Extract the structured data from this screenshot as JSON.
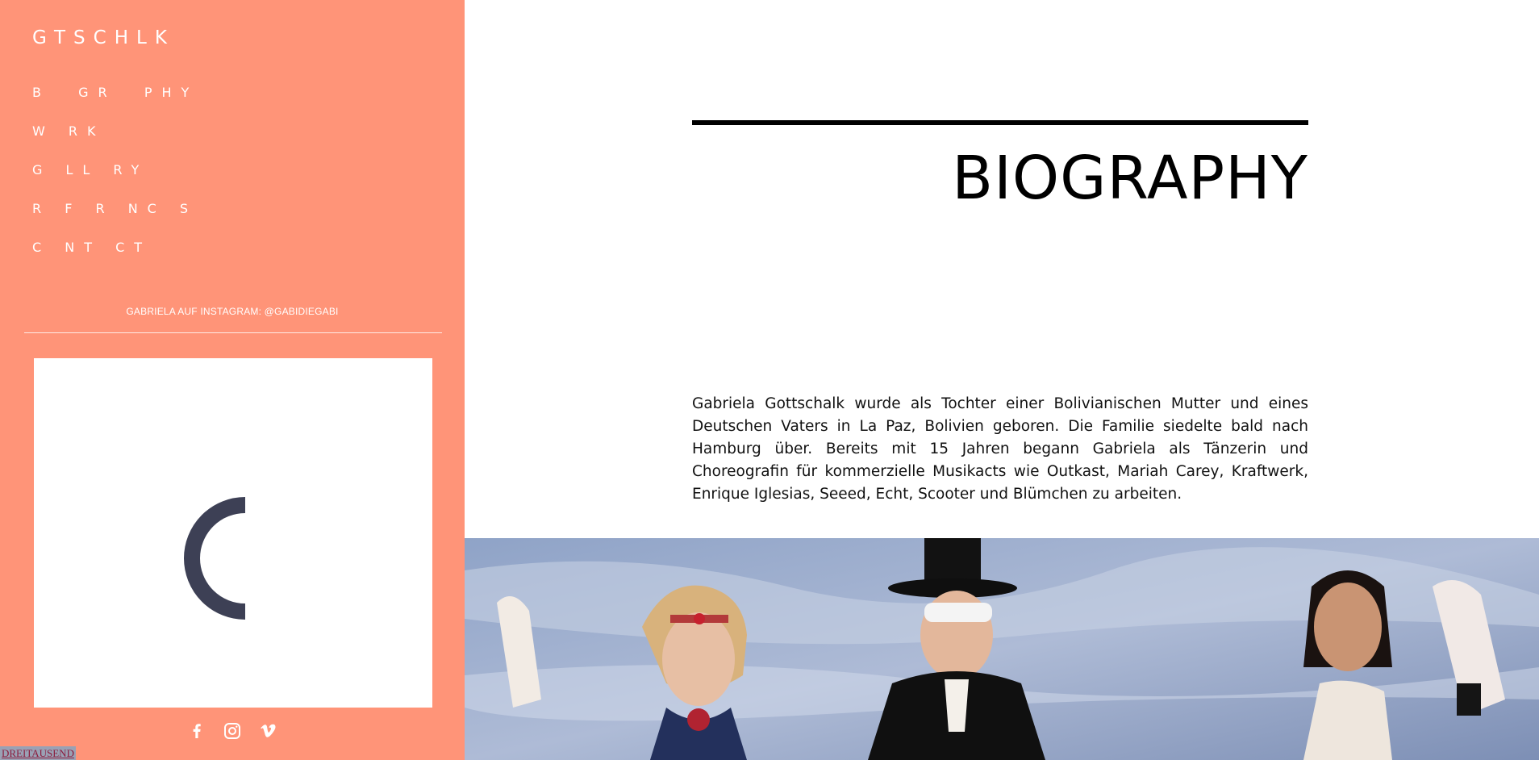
{
  "sidebar": {
    "logo": "GTSCHLK",
    "nav": [
      {
        "label": "B  GR  PHY"
      },
      {
        "label": "W RK"
      },
      {
        "label": "G LL RY"
      },
      {
        "label": "R F R NC S"
      },
      {
        "label": "C NT CT"
      }
    ],
    "instagram_text": "GABRIELA AUF INSTAGRAM: @GABIDIEGABI",
    "social_icons": [
      "facebook-icon",
      "instagram-icon",
      "vimeo-icon"
    ],
    "bottom_link": "DREITAUSEND"
  },
  "main": {
    "title": "BIOGRAPHY",
    "bio": "Gabriela Gottschalk wurde als Tochter einer Bolivianischen Mutter und eines Deutschen Vaters in La Paz, Bolivien geboren. Die Familie siedelte bald nach Hamburg über. Bereits mit 15 Jahren begann Gabriela als Tänzerin und Choreografin für kommerzielle Musikacts wie Outkast, Mariah Carey, Kraftwerk, Enrique Iglesias, Seeed, Echt, Scooter und Blümchen zu arbeiten."
  },
  "colors": {
    "sidebar_bg": "#ff9478",
    "loader": "#3d4055",
    "text": "#000000"
  }
}
